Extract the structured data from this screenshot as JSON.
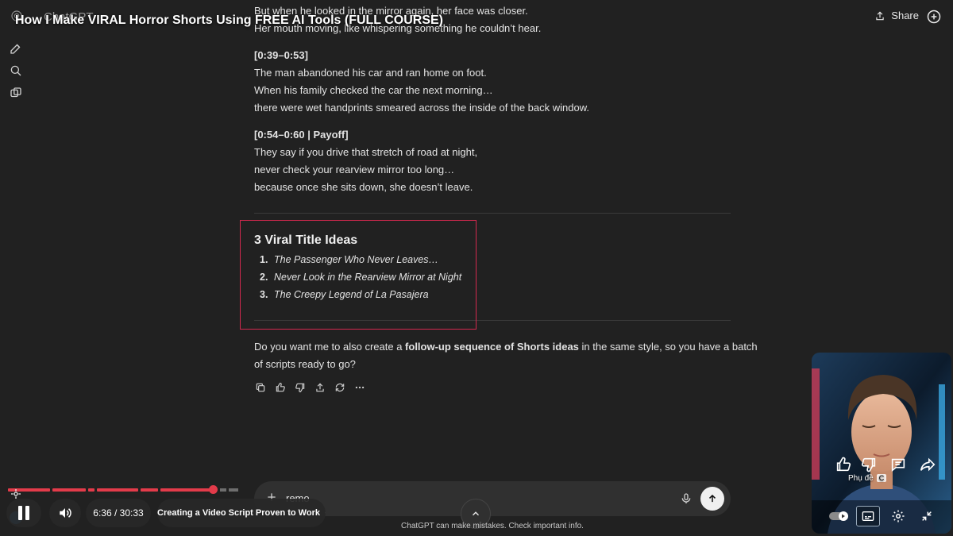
{
  "video": {
    "title": "How I Make VIRAL Horror Shorts Using FREE AI Tools (FULL COURSE)",
    "time": "6:36 / 30:33",
    "chapter": "Creating a Video Script Proven to Work",
    "progress_fraction": 0.218
  },
  "app": {
    "name": "ChatGPT",
    "share_label": "Share"
  },
  "chat": {
    "lines_top": [
      "But when he looked in the mirror again, her face was closer.",
      "Her mouth moving, like whispering something he couldn’t hear."
    ],
    "section2_heading": "[0:39–0:53]",
    "section2_lines": [
      "The man abandoned his car and ran home on foot.",
      "When his family checked the car the next morning…",
      "there were wet handprints smeared across the inside of the back window."
    ],
    "section3_heading": "[0:54–0:60 | Payoff]",
    "section3_lines": [
      "They say if you drive that stretch of road at night,",
      "never check your rearview mirror too long…",
      "because once she sits down, she doesn’t leave."
    ],
    "titles_heading": "3 Viral Title Ideas",
    "titles": [
      {
        "num": "1.",
        "text": "The Passenger Who Never Leaves…"
      },
      {
        "num": "2.",
        "text": "Never Look in the Rearview Mirror at Night"
      },
      {
        "num": "3.",
        "text": "The Creepy Legend of La Pasajera"
      }
    ],
    "followup_pre": "Do you want me to also create a ",
    "followup_bold": "follow-up sequence of Shorts ideas",
    "followup_post": " in the same style, so you have a batch",
    "followup_line2": "of scripts ready to go?"
  },
  "composer": {
    "value": "remo",
    "disclaimer": "ChatGPT can make mistakes. Check important info."
  },
  "pip": {
    "caption": "Phụ đề",
    "caption_key": "C"
  },
  "colors": {
    "background": "#212121",
    "highlight_border": "#d2284e",
    "progress": "#e33b4a"
  }
}
